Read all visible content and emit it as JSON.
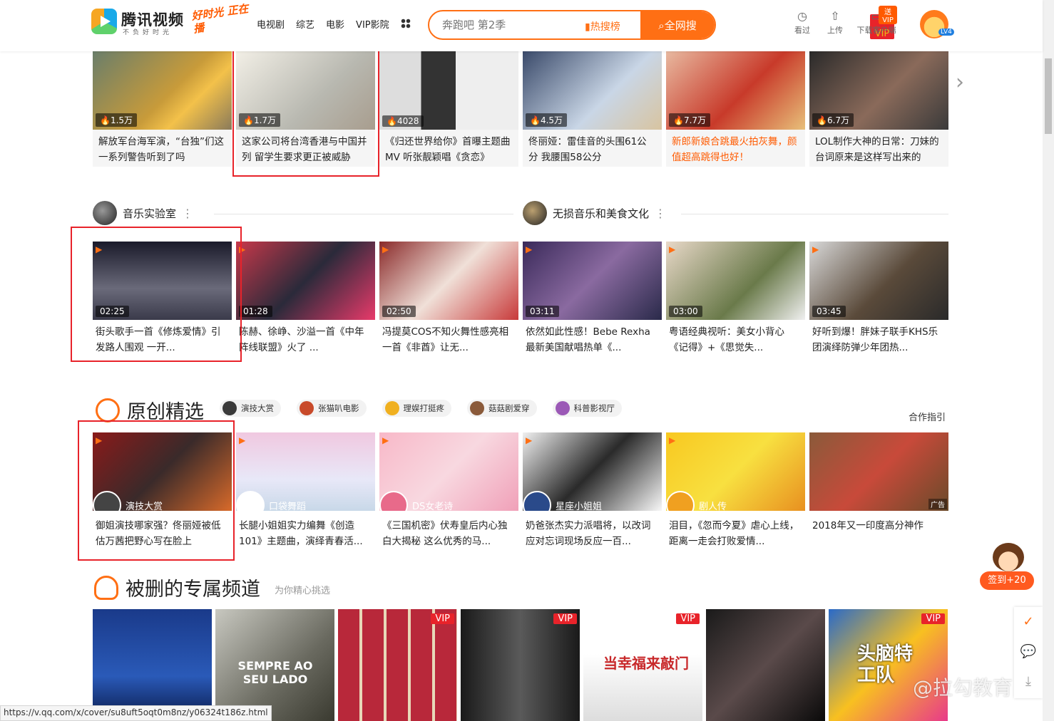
{
  "header": {
    "logo_name": "腾讯视频",
    "logo_slogan": "不负好时光",
    "promo": "好时光 正在播",
    "nav": [
      "电视剧",
      "综艺",
      "电影",
      "VIP影院"
    ],
    "search_placeholder": "奔跑吧 第2季",
    "hot_label": "热搜榜",
    "search_button": "全网搜",
    "tools": [
      {
        "icon": "star-icon",
        "label": "VIP"
      },
      {
        "icon": "clock-icon",
        "label": "看过"
      },
      {
        "icon": "upload-icon",
        "label": "上传"
      },
      {
        "icon": "download-icon",
        "label": "下载客户端"
      }
    ],
    "send_vip": "送VIP",
    "level": "LV4"
  },
  "hot_row": [
    {
      "count": "1.5万",
      "title": "解放军台海军演，“台独”们这一系列警告听到了吗",
      "highlight": false
    },
    {
      "count": "1.7万",
      "title": "这家公司将台湾香港与中国并列 留学生要求更正被威胁",
      "highlight": false
    },
    {
      "count": "4028",
      "title": "《归还世界给你》首曝主题曲MV 听张靓颖唱《贪恋》",
      "highlight": false
    },
    {
      "count": "4.5万",
      "title": "佟丽娅：雷佳音的头围61公分 我腰围58公分",
      "highlight": false
    },
    {
      "count": "7.7万",
      "title": "新郎新娘合跳最火拍灰舞，颜值超高跳得也好！",
      "highlight": true
    },
    {
      "count": "6.7万",
      "title": "LOL制作大神的日常：刀妹的台词原来是这样写出来的",
      "highlight": false
    }
  ],
  "channels": {
    "left": "音乐实验室",
    "right": "无损音乐和美食文化"
  },
  "music_row": [
    {
      "duration": "02:25",
      "title": "街头歌手一首《修炼爱情》引发路人围观 一开..."
    },
    {
      "duration": "01:28",
      "title": "陈赫、徐峥、沙溢一首《中年阵线联盟》火了 ..."
    },
    {
      "duration": "02:50",
      "title": "冯提莫COS不知火舞性感亮相 一首《非酋》让无..."
    },
    {
      "duration": "03:11",
      "title": "依然如此性感！Bebe Rexha最新美国献唱热单《..."
    },
    {
      "duration": "03:00",
      "title": "粤语经典视听：美女小背心《记得》+《思觉失..."
    },
    {
      "duration": "03:45",
      "title": "好听到爆！胖妹子联手KHS乐团演绎防弹少年团热..."
    }
  ],
  "original": {
    "heading": "原创精选",
    "chips": [
      "演技大赏",
      "张猫叭电影",
      "理娱打挺疼",
      "菇菇剧爱穿",
      "科普影视厅"
    ],
    "cooperate": "合作指引",
    "cards": [
      {
        "author": "演技大赏",
        "title": "御姐演技哪家强？佟丽娅被低估万茜把野心写在脸上"
      },
      {
        "author": "口袋舞蹈",
        "title": "长腿小姐姐实力编舞《创造101》主题曲，演绎青春活..."
      },
      {
        "author": "DS女老诗",
        "title": "《三国机密》伏寿皇后内心独白大揭秘 这么优秀的马..."
      },
      {
        "author": "星座小姐姐",
        "title": "奶爸张杰实力派唱将，以改词应对忘词现场反应一百..."
      },
      {
        "author": "剧人传",
        "title": "泪目，《忽而今夏》虐心上线，距离一走会打败爱情..."
      },
      {
        "author": "",
        "title": "2018年又一印度高分神作",
        "ad": "广告"
      }
    ]
  },
  "channel_section": {
    "heading": "被删的专属频道",
    "tagline": "为你精心挑选",
    "posters": [
      {
        "vip": ""
      },
      {
        "vip": "",
        "text": "SEMPRE AO SEU LADO"
      },
      {
        "vip": "VIP"
      },
      {
        "vip": "VIP"
      },
      {
        "vip": "VIP",
        "text": "当幸福来敲门"
      },
      {
        "vip": ""
      },
      {
        "vip": "VIP",
        "text": "头脑特工队"
      }
    ]
  },
  "checkin": "签到+20",
  "watermark": "@拉勾教育",
  "status_url": "https://v.qq.com/x/cover/su8uft5oqt0m8nz/y06324t186z.html",
  "colors": {
    "accent": "#ff6f14",
    "highlight_box": "#e8232a",
    "vip": "#e8232a"
  }
}
